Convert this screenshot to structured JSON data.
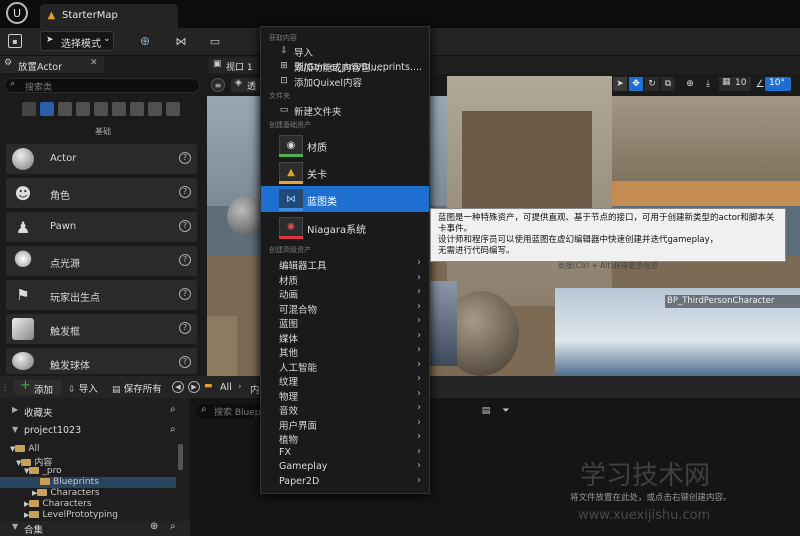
{
  "app": {
    "tab_title": "StarterMap"
  },
  "toolbar": {
    "mode_label": "选择模式"
  },
  "place_panel": {
    "tab_label": "放置Actor",
    "search_placeholder": "搜索类",
    "category_label": "基础",
    "items": [
      {
        "label": "Actor"
      },
      {
        "label": "角色"
      },
      {
        "label": "Pawn"
      },
      {
        "label": "点光源"
      },
      {
        "label": "玩家出生点"
      },
      {
        "label": "触发框"
      },
      {
        "label": "触发球体"
      }
    ]
  },
  "viewport": {
    "tab_label": "视口 1",
    "perspective_label": "透",
    "snap_grid": "10",
    "snap_rot": "10°",
    "object_label": "BP_ThirdPersonCharacter"
  },
  "content_browser": {
    "add_label": "添加",
    "import_label": "导入",
    "save_all_label": "保存所有",
    "path_all": "All",
    "path_more": "内",
    "favorites_label": "收藏夹",
    "project_label": "project1023",
    "search_placeholder": "搜索 Blueprints",
    "tree": [
      {
        "label": "All",
        "indent": 0,
        "selected": false
      },
      {
        "label": "内容",
        "indent": 1,
        "selected": false
      },
      {
        "label": "_pro",
        "indent": 2,
        "selected": false
      },
      {
        "label": "Blueprints",
        "indent": 3,
        "selected": true
      },
      {
        "label": "Characters",
        "indent": 3,
        "selected": false
      },
      {
        "label": "Characters",
        "indent": 2,
        "selected": false
      },
      {
        "label": "LevelPrototyping",
        "indent": 2,
        "selected": false
      }
    ],
    "collections_label": "合集",
    "drop_hint": "将文件放置在此处，或点击右键创建内容。"
  },
  "context_menu": {
    "sec_get": "获取内容",
    "get_items": [
      {
        "label": "导入到/Game/_pro/Blueprints...."
      },
      {
        "label": "添加功能或内容包...."
      },
      {
        "label": "添加Quixel内容"
      }
    ],
    "sec_folder": "文件夹",
    "new_folder": "新建文件夹",
    "sec_basic": "创建基础资产",
    "basic_items": [
      {
        "label": "材质",
        "color": "#4caf50"
      },
      {
        "label": "关卡",
        "color": "#e8a23a"
      },
      {
        "label": "蓝图类",
        "color": "#3d8ee0"
      },
      {
        "label": "Niagara系统",
        "color": "#d93838"
      }
    ],
    "sec_advanced": "创建高级资产",
    "submenus": [
      {
        "label": "编辑器工具"
      },
      {
        "label": "材质"
      },
      {
        "label": "动画"
      },
      {
        "label": "可混合物"
      },
      {
        "label": "蓝图"
      },
      {
        "label": "媒体"
      },
      {
        "label": "其他"
      },
      {
        "label": "人工智能"
      },
      {
        "label": "纹理"
      },
      {
        "label": "物理"
      },
      {
        "label": "音效"
      },
      {
        "label": "用户界面"
      },
      {
        "label": "植物"
      },
      {
        "label": "FX"
      },
      {
        "label": "Gameplay"
      },
      {
        "label": "Paper2D"
      }
    ]
  },
  "tooltip": {
    "line1": "蓝图是一种特殊资产，可提供直观、基于节点的接口，可用于创建新类型的actor和脚本关卡事件。",
    "line2": "设计师和程序员可以使用蓝图在虚幻编辑器中快速创建并迭代gameplay，",
    "line3": "无需进行代码编写。",
    "hint": "长按(Ctrl + Alt)获得更多信息"
  },
  "watermark": {
    "title": "学习技术网",
    "url": "www.xuexijishu.com"
  },
  "colors": {
    "selected_menu": "#1f6fd0",
    "accent_add": "#3fae3f"
  }
}
